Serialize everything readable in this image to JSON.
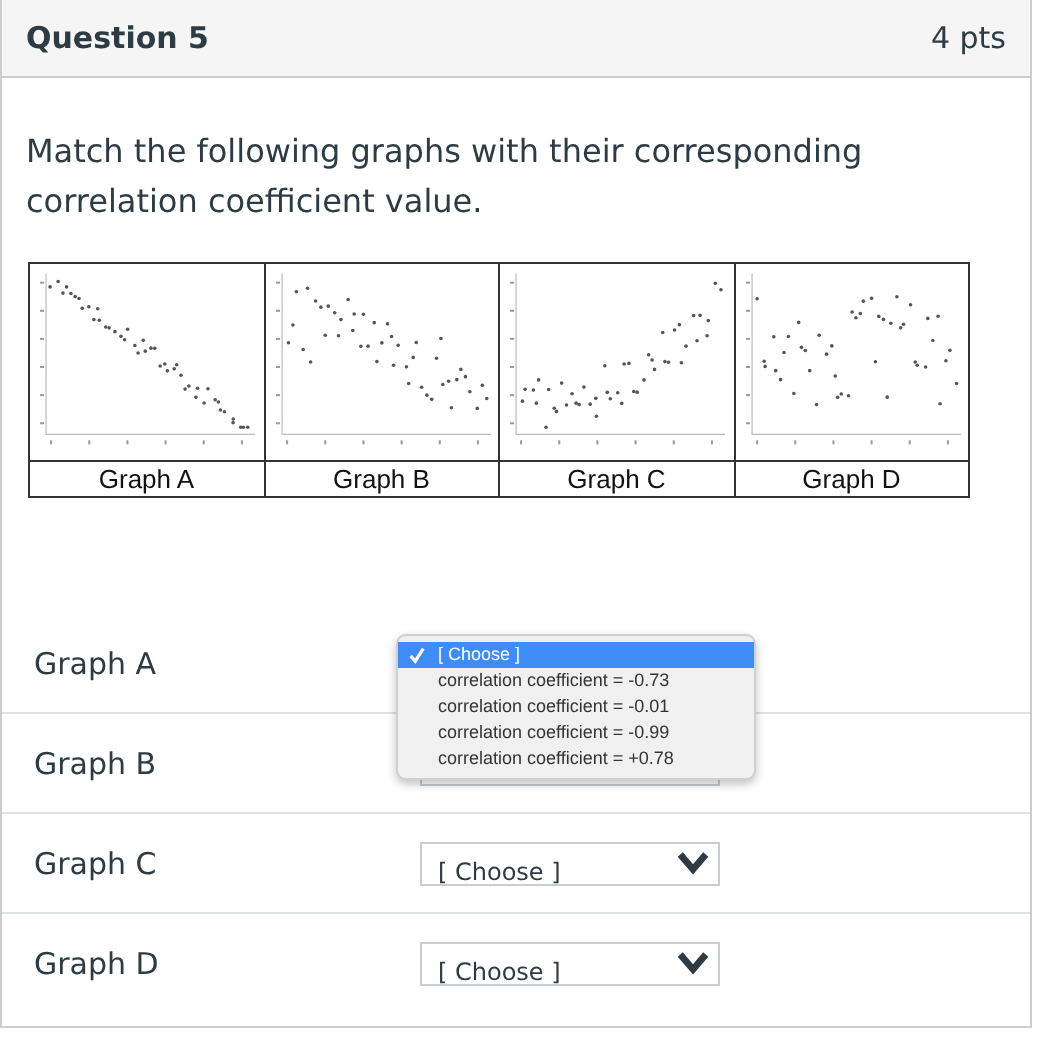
{
  "header": {
    "title": "Question 5",
    "points": "4 pts"
  },
  "prompt": "Match the following graphs with their corresponding correlation coefficient value.",
  "graphs": [
    {
      "label": "Graph A",
      "kind": "linedown"
    },
    {
      "label": "Graph B",
      "kind": "driftdown"
    },
    {
      "label": "Graph C",
      "kind": "curveup"
    },
    {
      "label": "Graph D",
      "kind": "none"
    }
  ],
  "matches": [
    {
      "label": "Graph A"
    },
    {
      "label": "Graph B"
    },
    {
      "label": "Graph C",
      "value": "[ Choose ]"
    },
    {
      "label": "Graph D",
      "value": "[ Choose ]"
    }
  ],
  "dropdown": {
    "options": [
      {
        "label": "[ Choose ]",
        "selected": true
      },
      {
        "label": "correlation coefficient = -0.73",
        "selected": false
      },
      {
        "label": "correlation coefficient = -0.01",
        "selected": false
      },
      {
        "label": "correlation coefficient = -0.99",
        "selected": false
      },
      {
        "label": "correlation coefficient = +0.78",
        "selected": false
      }
    ]
  }
}
